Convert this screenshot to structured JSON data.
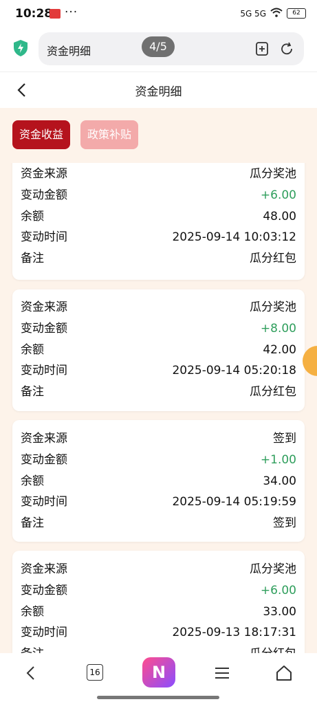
{
  "status_bar": {
    "time": "10:28",
    "dots": "···",
    "network": "5G 5G",
    "battery": "62"
  },
  "browser": {
    "address_title": "资金明细",
    "pager": "4/5"
  },
  "header": {
    "title": "资金明细"
  },
  "tabs": [
    {
      "label": "资金收益",
      "active": true
    },
    {
      "label": "政策补贴",
      "active": false
    }
  ],
  "records": [
    {
      "source_label": "资金来源",
      "source": "瓜分奖池",
      "amount_label": "变动金额",
      "amount": "+6.00",
      "balance_label": "余额",
      "balance": "48.00",
      "time_label": "变动时间",
      "time": "2025-09-14 10:03:12",
      "note_label": "备注",
      "note": "瓜分红包"
    },
    {
      "source_label": "资金来源",
      "source": "瓜分奖池",
      "amount_label": "变动金额",
      "amount": "+8.00",
      "balance_label": "余额",
      "balance": "42.00",
      "time_label": "变动时间",
      "time": "2025-09-14 05:20:18",
      "note_label": "备注",
      "note": "瓜分红包"
    },
    {
      "source_label": "资金来源",
      "source": "签到",
      "amount_label": "变动金额",
      "amount": "+1.00",
      "balance_label": "余额",
      "balance": "34.00",
      "time_label": "变动时间",
      "time": "2025-09-14 05:19:59",
      "note_label": "备注",
      "note": "签到"
    },
    {
      "source_label": "资金来源",
      "source": "瓜分奖池",
      "amount_label": "变动金额",
      "amount": "+6.00",
      "balance_label": "余额",
      "balance": "33.00",
      "time_label": "变动时间",
      "time": "2025-09-13 18:17:31",
      "note_label": "备注",
      "note": "瓜分红包"
    }
  ],
  "bottom_nav": {
    "tab_count": "16",
    "logo_letter": "N"
  },
  "colors": {
    "accent": "#b5131d",
    "tab_inactive": "#f3aaaa",
    "positive": "#2f9e5c",
    "page_bg": "#fdf3ea"
  }
}
